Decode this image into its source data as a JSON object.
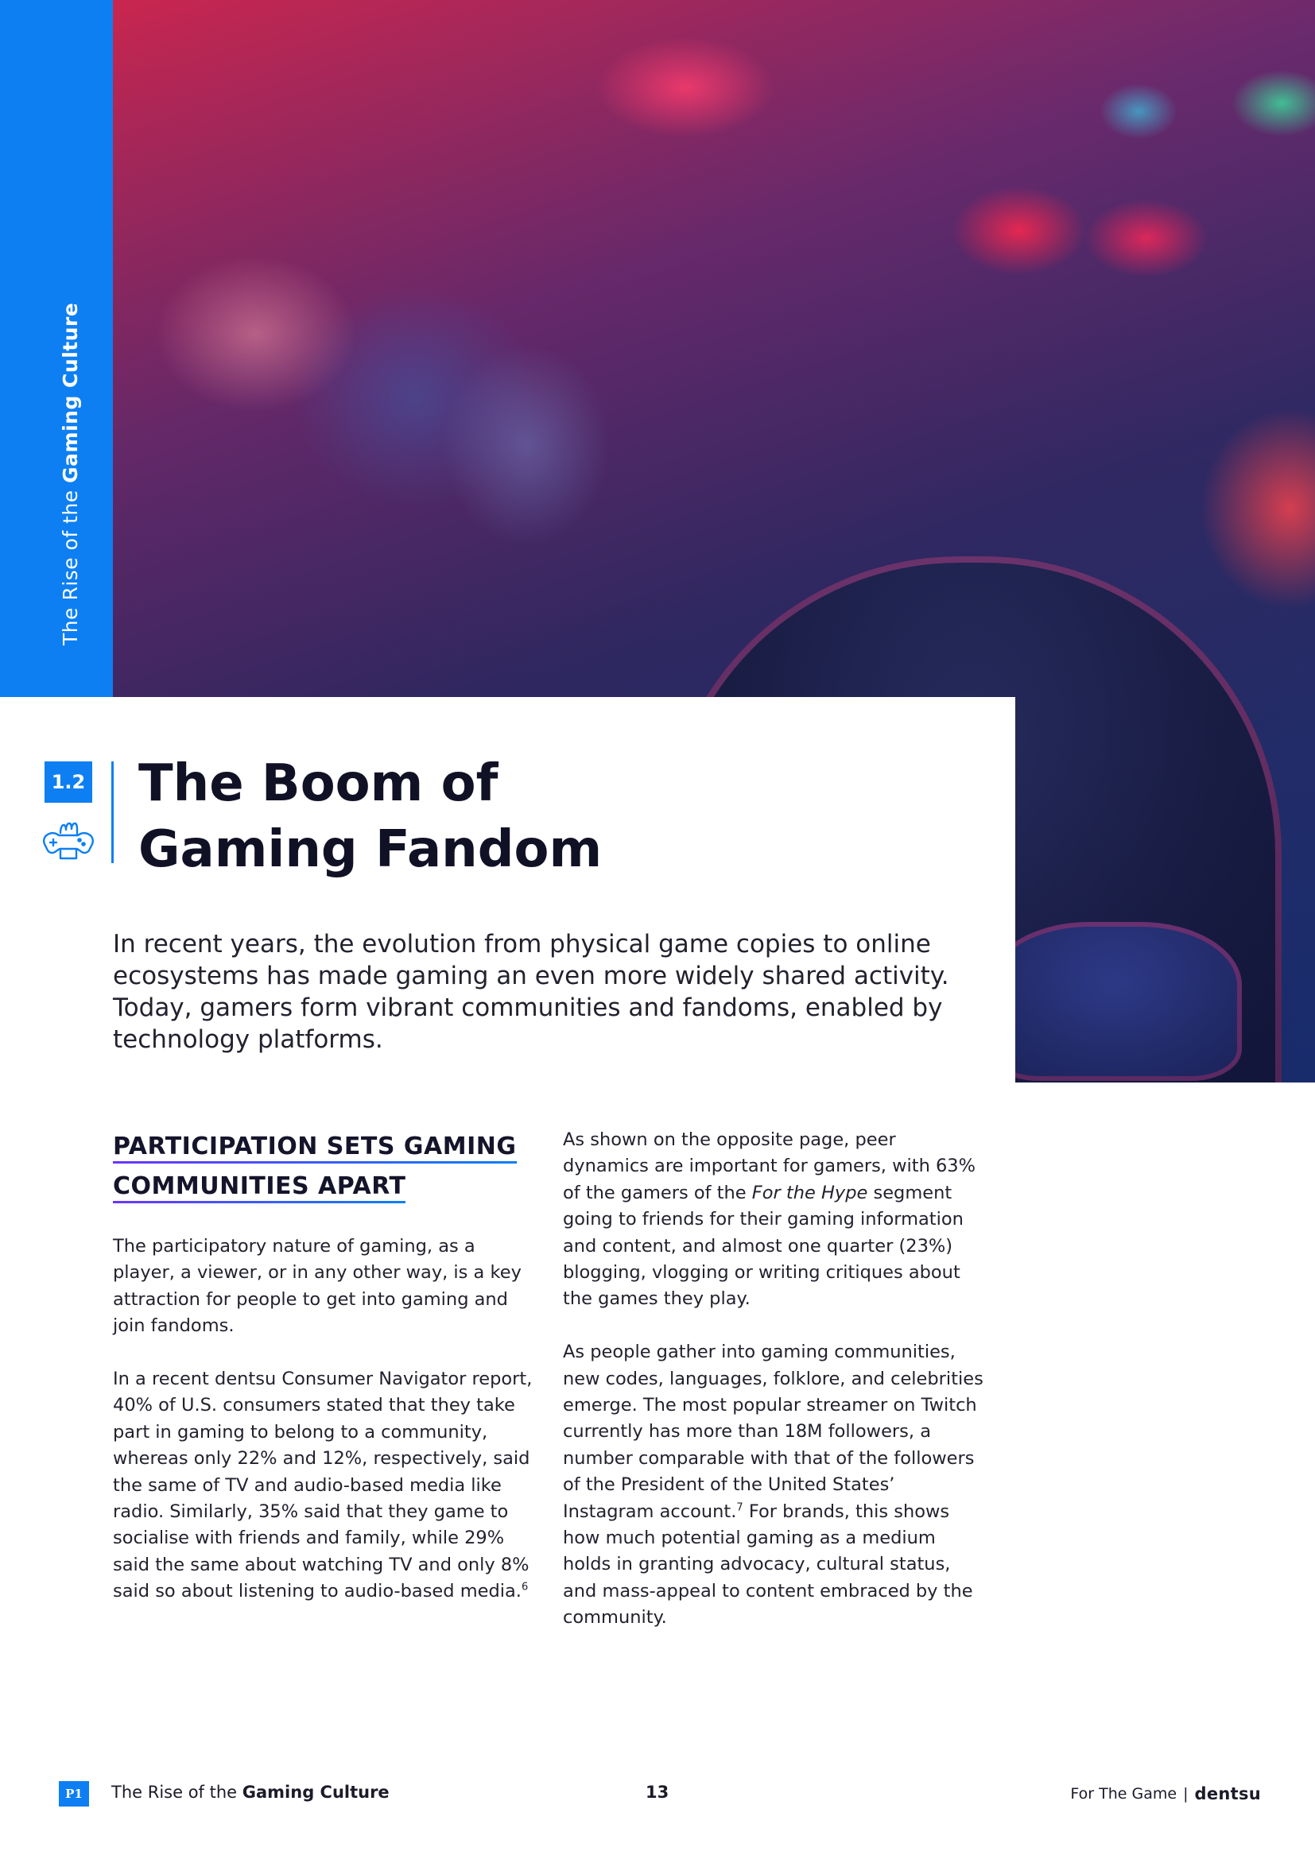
{
  "sidebar": {
    "tab_prefix": "The Rise of the ",
    "tab_bold": "Gaming Culture"
  },
  "section": {
    "number": "1.2",
    "icon": "fan-gamepad-icon",
    "title_line1": "The Boom of",
    "title_line2": "Gaming Fandom"
  },
  "intro": "In recent years, the evolution from physical game copies to online ecosystems has made gaming an even more widely shared activity. Today, gamers form vibrant communities and fandoms, enabled by technology platforms.",
  "left_column": {
    "heading_line1": "PARTICIPATION SETS GAMING",
    "heading_line2": "COMMUNITIES APART",
    "para1": "The participatory nature of gaming, as a player, a viewer, or in any other way, is a key attraction for people to get into gaming and join fandoms.",
    "para2": "In a recent dentsu Consumer Navigator report, 40% of U.S. consumers stated that they take part in gaming to belong to a community, whereas only 22% and 12%, respectively, said the same of TV and audio-based media like radio. Similarly, 35% said that they game to socialise with friends and family, while 29% said the same about watching TV and only 8% said so about listening to audio-based media.",
    "para2_footnote": "6"
  },
  "right_column": {
    "para1_a": "As shown on the opposite page, peer dynamics are important for gamers, with 63% of the gamers of the ",
    "para1_em": "For the Hype",
    "para1_b": " segment going to friends for their gaming information and content, and almost one quarter (23%) blogging, vlogging or writing critiques about the games they play.",
    "para2_a": "As people gather into gaming communities, new codes, languages, folklore, and celebrities emerge. The most popular streamer on Twitch currently has more than 18M followers, a number comparable with that of the followers of the President of the United States’ Instagram account.",
    "para2_footnote": "7",
    "para2_b": " For brands, this shows how much potential gaming as a medium holds in granting advocacy, cultural status, and mass-appeal to content embraced by the community."
  },
  "footer": {
    "badge": "P1",
    "left_prefix": "The Rise of the ",
    "left_bold": "Gaming Culture",
    "page_number": "13",
    "right_text": "For The Game",
    "separator": "|",
    "brand": "dentsu"
  },
  "colors": {
    "accent_blue": "#0d7ff2",
    "underline_gradient_start": "#6a35ff",
    "text_dark": "#111126"
  }
}
